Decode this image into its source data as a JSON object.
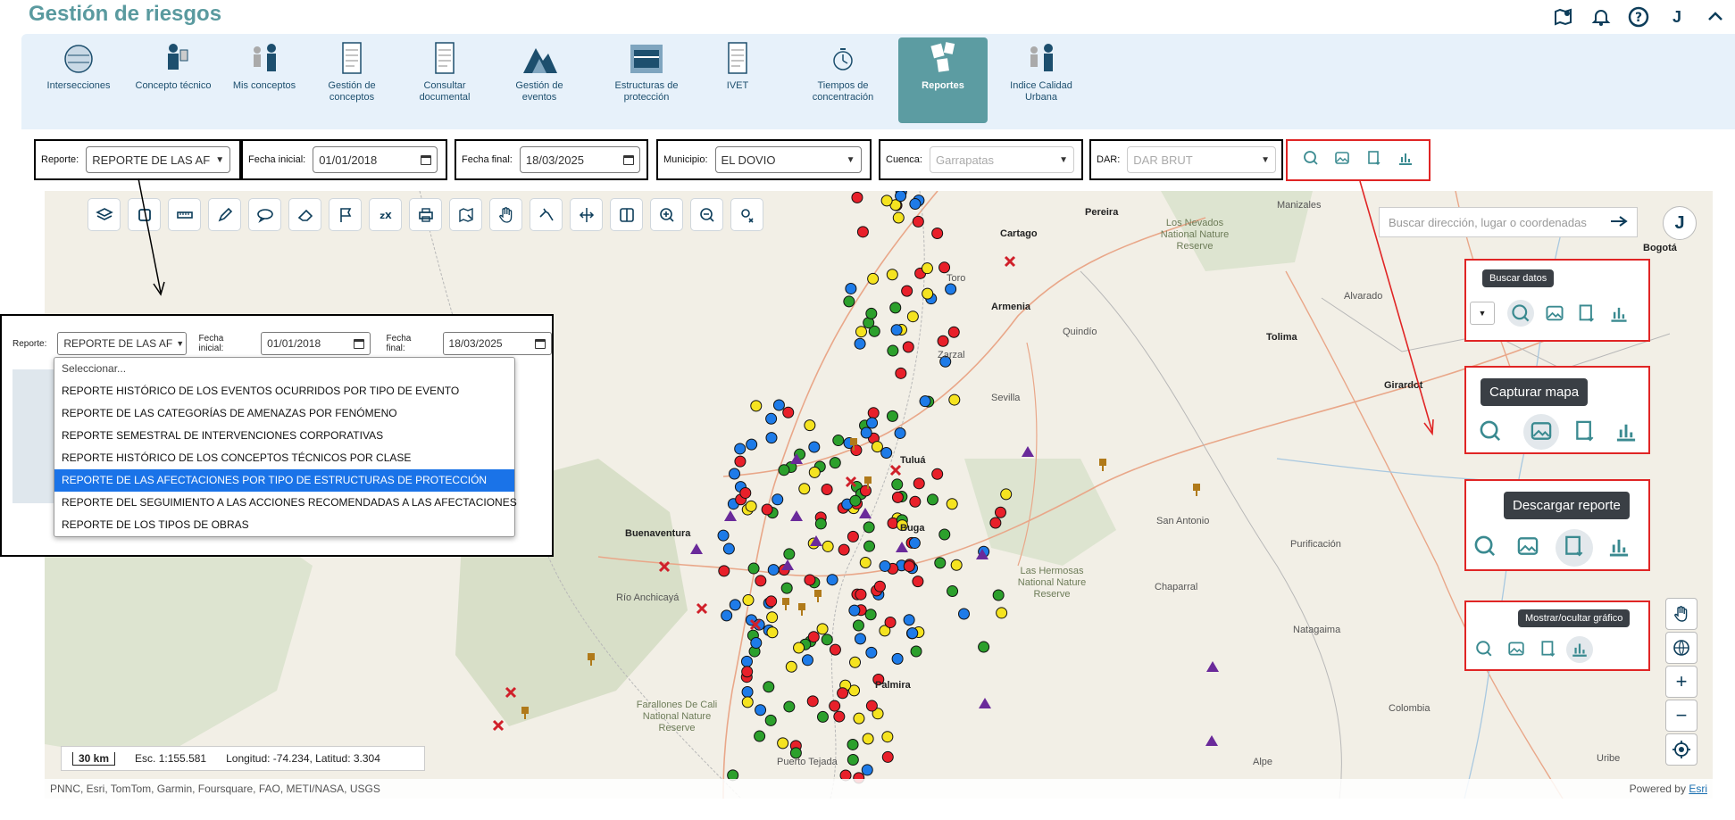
{
  "header": {
    "title": "Gestión de riesgos",
    "avatar_letter": "J"
  },
  "modules": [
    {
      "label": "Intersecciones"
    },
    {
      "label": "Concepto técnico"
    },
    {
      "label": "Mis conceptos"
    },
    {
      "label": "Gestión de conceptos"
    },
    {
      "label": "Consultar documental"
    },
    {
      "label": "Gestión de eventos"
    },
    {
      "label": "Estructuras de protección"
    },
    {
      "label": "IVET"
    },
    {
      "label": "Tiempos de concentración"
    },
    {
      "label": "Reportes",
      "active": true
    },
    {
      "label": "Indice Calidad Urbana"
    }
  ],
  "filters": {
    "reporte_label": "Reporte:",
    "reporte_value": "REPORTE DE LAS AF",
    "fecha_inicial_label": "Fecha inicial:",
    "fecha_inicial_value": "01/01/2018",
    "fecha_final_label": "Fecha final:",
    "fecha_final_value": "18/03/2025",
    "municipio_label": "Municipio:",
    "municipio_value": "EL DOVIO",
    "cuenca_label": "Cuenca:",
    "cuenca_value": "Garrapatas",
    "dar_label": "DAR:",
    "dar_value": "DAR BRUT"
  },
  "map": {
    "search_placeholder": "Buscar dirección, lugar o coordenadas",
    "avatar_letter": "J",
    "scale": {
      "bar": "30 km",
      "esc": "Esc. 1:155.581",
      "coords": "Longitud: -74.234, Latitud: 3.304"
    },
    "attribution": "PNNC, Esri, TomTom, Garmin, Foursquare, FAO, METI/NASA, USGS",
    "powered_by": "Powered by",
    "esri": "Esri",
    "zoom_in": "+",
    "zoom_out": "−",
    "places": [
      {
        "name": "Pereira",
        "type": "city"
      },
      {
        "name": "Los Nevados National Nature Reserve",
        "type": "park"
      },
      {
        "name": "Cartago",
        "type": "city"
      },
      {
        "name": "Manizales"
      },
      {
        "name": "Armenia",
        "type": "city"
      },
      {
        "name": "Quindío"
      },
      {
        "name": "Alvarado"
      },
      {
        "name": "Tolima",
        "type": "city"
      },
      {
        "name": "Girardot",
        "type": "city"
      },
      {
        "name": "Sevilla"
      },
      {
        "name": "Tuluá",
        "type": "city"
      },
      {
        "name": "Buga",
        "type": "city"
      },
      {
        "name": "Buenaventura",
        "type": "city"
      },
      {
        "name": "Río Anchicayá"
      },
      {
        "name": "Palmira",
        "type": "city"
      },
      {
        "name": "Farallones De Cali National Nature Reserve",
        "type": "park"
      },
      {
        "name": "Las Hermosas National Nature Reserve",
        "type": "park"
      },
      {
        "name": "San Antonio"
      },
      {
        "name": "Purificación"
      },
      {
        "name": "Chaparral"
      },
      {
        "name": "Natagaima"
      },
      {
        "name": "Colombia"
      },
      {
        "name": "Alpe"
      },
      {
        "name": "Uribe"
      },
      {
        "name": "Puerto Tejada"
      },
      {
        "name": "Zarzal"
      },
      {
        "name": "Toro"
      },
      {
        "name": "Bogotá",
        "type": "city"
      }
    ]
  },
  "callouts": {
    "buscar": "Buscar datos",
    "capturar": "Capturar mapa",
    "descargar": "Descargar reporte",
    "grafico": "Mostrar/ocultar gráfico"
  },
  "inset": {
    "reporte_label": "Reporte:",
    "reporte_value": "REPORTE DE LAS AF",
    "fecha_inicial_label": "Fecha inicial:",
    "fecha_inicial_value": "01/01/2018",
    "fecha_final_label": "Fecha final:",
    "fecha_final_value": "18/03/2025",
    "options": [
      "Seleccionar...",
      "REPORTE HISTÓRICO DE LOS EVENTOS OCURRIDOS POR TIPO DE EVENTO",
      "REPORTE DE LAS CATEGORÍAS DE AMENAZAS POR FENÓMENO",
      "REPORTE SEMESTRAL DE INTERVENCIONES CORPORATIVAS",
      "REPORTE HISTÓRICO DE LOS CONCEPTOS TÉCNICOS POR CLASE",
      "REPORTE DE LAS AFECTACIONES POR TIPO DE ESTRUCTURAS DE PROTECCIÓN",
      "REPORTE DEL SEGUIMIENTO A LAS ACCIONES RECOMENDADAS A LAS AFECTACIONES",
      "REPORTE DE LOS TIPOS DE OBRAS"
    ],
    "selected_index": 5
  },
  "colors": {
    "accent": "#5c9ca2",
    "title": "#5a9a9f",
    "red_box": "#e02525",
    "marker_red": "#e8202a",
    "marker_blue": "#1e7be8",
    "marker_green": "#2ca02c",
    "marker_yellow": "#f5e320",
    "marker_purple": "#6a2a9a",
    "marker_brown": "#b07a1a"
  }
}
